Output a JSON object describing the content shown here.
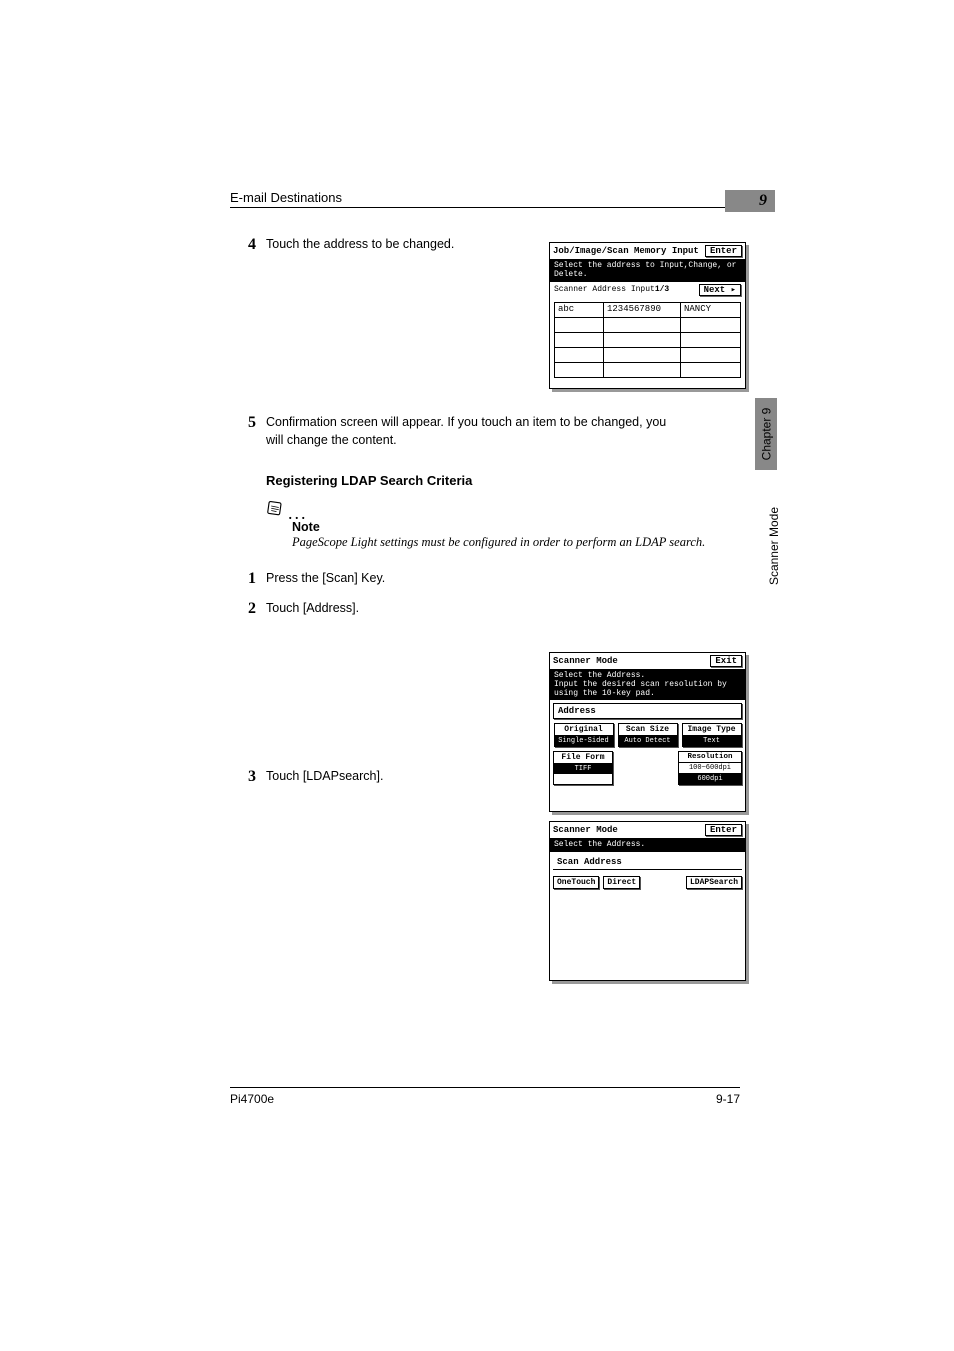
{
  "header": {
    "title": "E-mail Destinations",
    "chapter_num": "9"
  },
  "side": {
    "chapter": "Chapter 9",
    "mode": "Scanner Mode"
  },
  "steps_a": [
    {
      "num": "4",
      "text": "Touch the address to be changed."
    },
    {
      "num": "5",
      "text": "Confirmation screen will appear. If you touch an item to be changed, you will change the content."
    }
  ],
  "subheading": "Registering LDAP Search Criteria",
  "note": {
    "label": "Note",
    "text": "PageScope Light settings must be configured in order to perform an LDAP search."
  },
  "steps_b": [
    {
      "num": "1",
      "text": "Press the [Scan] Key."
    },
    {
      "num": "2",
      "text": "Touch [Address]."
    },
    {
      "num": "3",
      "text": "Touch [LDAPsearch]."
    }
  ],
  "panel1": {
    "title": "Job/Image/Scan Memory Input",
    "enter": "Enter",
    "msg": "Select the address to Input,Change, or Delete.",
    "subleft": "Scanner Address Input",
    "subpage": "1/3",
    "next": "Next ▸",
    "row": {
      "c1": "abc",
      "c2": "1234567890",
      "c3": "NANCY"
    }
  },
  "panel2": {
    "title": "Scanner Mode",
    "exit": "Exit",
    "msg1": "Select the Address.",
    "msg2": "Input the desired scan resolution by using the 10-key pad.",
    "address": "Address",
    "t1_top": "Original",
    "t1_bot": "Single-Sided",
    "t2_top": "Scan Size",
    "t2_bot": "Auto Detect",
    "t3_top": "Image Type",
    "t3_bot": "Text",
    "t4_top": "File Form",
    "t4_bot": "TIFF",
    "t5_top": "Resolution",
    "t5_mid": "100~600dpi",
    "t5_bot": "600dpi"
  },
  "panel3": {
    "title": "Scanner Mode",
    "enter": "Enter",
    "msg": "Select the Address.",
    "scan_address": "Scan Address",
    "b1": "OneTouch",
    "b2": "Direct",
    "b3": "LDAPSearch"
  },
  "footer": {
    "left": "Pi4700e",
    "right": "9-17"
  }
}
